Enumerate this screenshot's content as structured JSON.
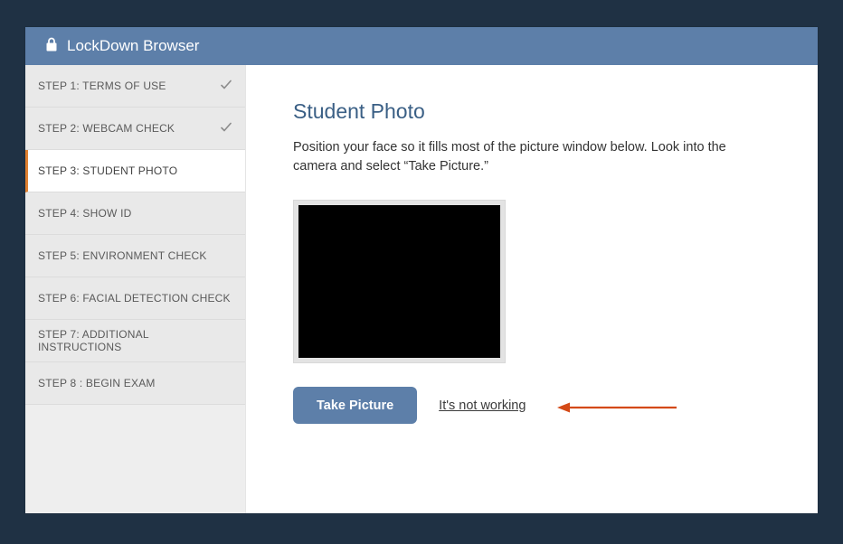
{
  "title": "LockDown Browser",
  "sidebar": {
    "items": [
      {
        "label": "STEP 1: TERMS OF USE",
        "done": true,
        "active": false
      },
      {
        "label": "STEP 2: WEBCAM CHECK",
        "done": true,
        "active": false
      },
      {
        "label": "STEP 3: STUDENT PHOTO",
        "done": false,
        "active": true
      },
      {
        "label": "STEP 4: SHOW ID",
        "done": false,
        "active": false
      },
      {
        "label": "STEP 5: ENVIRONMENT CHECK",
        "done": false,
        "active": false
      },
      {
        "label": "STEP 6: FACIAL DETECTION CHECK",
        "done": false,
        "active": false
      },
      {
        "label": "STEP 7: ADDITIONAL INSTRUCTIONS",
        "done": false,
        "active": false
      },
      {
        "label": "STEP 8 : BEGIN EXAM",
        "done": false,
        "active": false
      }
    ]
  },
  "main": {
    "heading": "Student Photo",
    "instructions": "Position your face so it fills most of the picture window below. Look into the camera and select “Take Picture.”",
    "take_picture_label": "Take Picture",
    "not_working_label": "It's not working"
  }
}
